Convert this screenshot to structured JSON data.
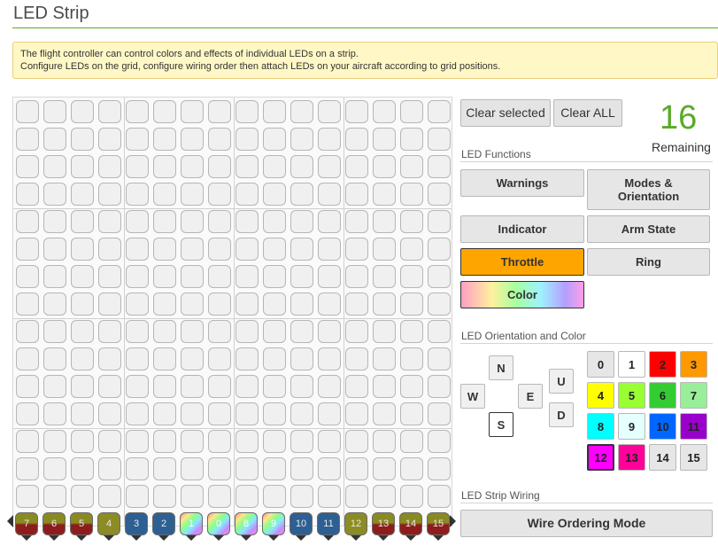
{
  "title": "LED Strip",
  "note": {
    "line1": "The flight controller can control colors and effects of individual LEDs on a strip.",
    "line2": "Configure LEDs on the grid, configure wiring order then attach LEDs on your aircraft according to grid positions."
  },
  "buttons": {
    "clear_selected": "Clear selected",
    "clear_all": "Clear ALL"
  },
  "remaining": {
    "count": "16",
    "label": "Remaining"
  },
  "functions": {
    "heading": "LED Functions",
    "warnings": "Warnings",
    "modes": "Modes & Orientation",
    "indicator": "Indicator",
    "arm_state": "Arm State",
    "throttle": "Throttle",
    "ring": "Ring",
    "color": "Color"
  },
  "orientation": {
    "heading": "LED Orientation and Color",
    "n": "N",
    "w": "W",
    "e": "E",
    "s": "S",
    "u": "U",
    "d": "D",
    "colors": [
      {
        "label": "0",
        "hex": "#e6e6e6"
      },
      {
        "label": "1",
        "hex": "#ffffff"
      },
      {
        "label": "2",
        "hex": "#ff0000"
      },
      {
        "label": "3",
        "hex": "#ff9900"
      },
      {
        "label": "4",
        "hex": "#ffff00"
      },
      {
        "label": "5",
        "hex": "#99ff33"
      },
      {
        "label": "6",
        "hex": "#33cc33"
      },
      {
        "label": "7",
        "hex": "#99ee99"
      },
      {
        "label": "8",
        "hex": "#00ffff"
      },
      {
        "label": "9",
        "hex": "#e6ffff"
      },
      {
        "label": "10",
        "hex": "#0066ff"
      },
      {
        "label": "11",
        "hex": "#9900cc"
      },
      {
        "label": "12",
        "hex": "#ff00ff"
      },
      {
        "label": "13",
        "hex": "#ff0099"
      },
      {
        "label": "14",
        "hex": "#e6e6e6"
      },
      {
        "label": "15",
        "hex": "#e6e6e6"
      }
    ]
  },
  "wiring": {
    "heading": "LED Strip Wiring",
    "mode_button": "Wire Ordering Mode",
    "bottom_row": [
      {
        "label": "7",
        "style": "c-red"
      },
      {
        "label": "6",
        "style": "c-red"
      },
      {
        "label": "5",
        "style": "c-red"
      },
      {
        "label": "4",
        "style": "c-olive"
      },
      {
        "label": "3",
        "style": "c-blue"
      },
      {
        "label": "2",
        "style": "c-blue"
      },
      {
        "label": "1",
        "style": "c-rainbow"
      },
      {
        "label": "0",
        "style": "c-rainbow"
      },
      {
        "label": "8",
        "style": "c-rainbow"
      },
      {
        "label": "9",
        "style": "c-rainbow"
      },
      {
        "label": "10",
        "style": "c-blue"
      },
      {
        "label": "11",
        "style": "c-blue"
      },
      {
        "label": "12",
        "style": "c-olive"
      },
      {
        "label": "13",
        "style": "c-red"
      },
      {
        "label": "14",
        "style": "c-red"
      },
      {
        "label": "15",
        "style": "c-red"
      }
    ]
  }
}
